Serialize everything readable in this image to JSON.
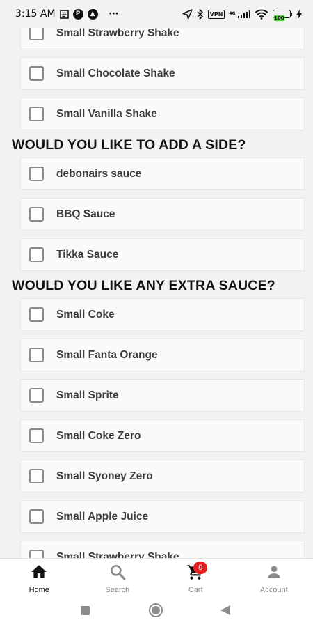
{
  "status_bar": {
    "time": "3:15 AM",
    "vpn_label": "VPN",
    "network": "4G",
    "battery_level": "100",
    "more_dots": "⋯"
  },
  "sections": [
    {
      "title": "",
      "options": [
        "Small Strawberry Shake",
        "Small Chocolate Shake",
        "Small Vanilla Shake"
      ]
    },
    {
      "title": "WOULD YOU LIKE TO ADD A SIDE?",
      "options": [
        "debonairs sauce",
        "BBQ Sauce",
        "Tikka Sauce"
      ]
    },
    {
      "title": "WOULD YOU LIKE ANY EXTRA SAUCE?",
      "options": [
        "Small Coke",
        "Small Fanta Orange",
        "Small Sprite",
        "Small Coke Zero",
        "Small Syoney Zero",
        "Small Apple Juice",
        "Small Strawberry Shake"
      ]
    }
  ],
  "bottom_nav": {
    "items": [
      {
        "label": "Home",
        "icon": "home-icon",
        "active": true
      },
      {
        "label": "Search",
        "icon": "search-icon",
        "active": false
      },
      {
        "label": "Cart",
        "icon": "cart-icon",
        "active": false,
        "badge": "0"
      },
      {
        "label": "Account",
        "icon": "account-icon",
        "active": false
      }
    ]
  },
  "colors": {
    "badge": "#e11d1d",
    "battery": "#4cd137",
    "background": "#f2f2f2"
  }
}
